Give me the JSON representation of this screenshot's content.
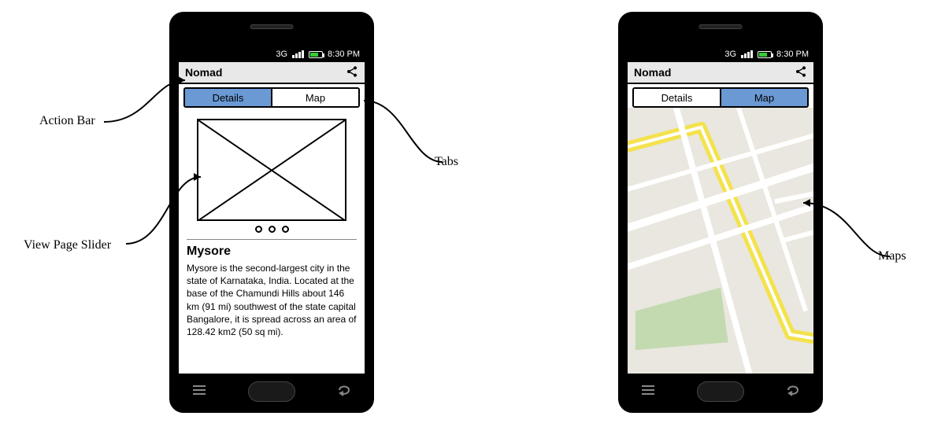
{
  "status": {
    "network": "3G",
    "time": "8:30 PM"
  },
  "action_bar": {
    "title": "Nomad"
  },
  "tabs": {
    "details": "Details",
    "map": "Map"
  },
  "details": {
    "title": "Mysore",
    "body": "Mysore is the second-largest city in the state of Karnataka, India. Located at the base of the Chamundi Hills about 146 km (91 mi) southwest of the state capital Bangalore, it is spread across an area of 128.42 km2 (50 sq mi)."
  },
  "annotations": {
    "action_bar": "Action Bar",
    "view_page_slider": "View Page Slider",
    "tabs": "Tabs",
    "maps": "Maps"
  }
}
